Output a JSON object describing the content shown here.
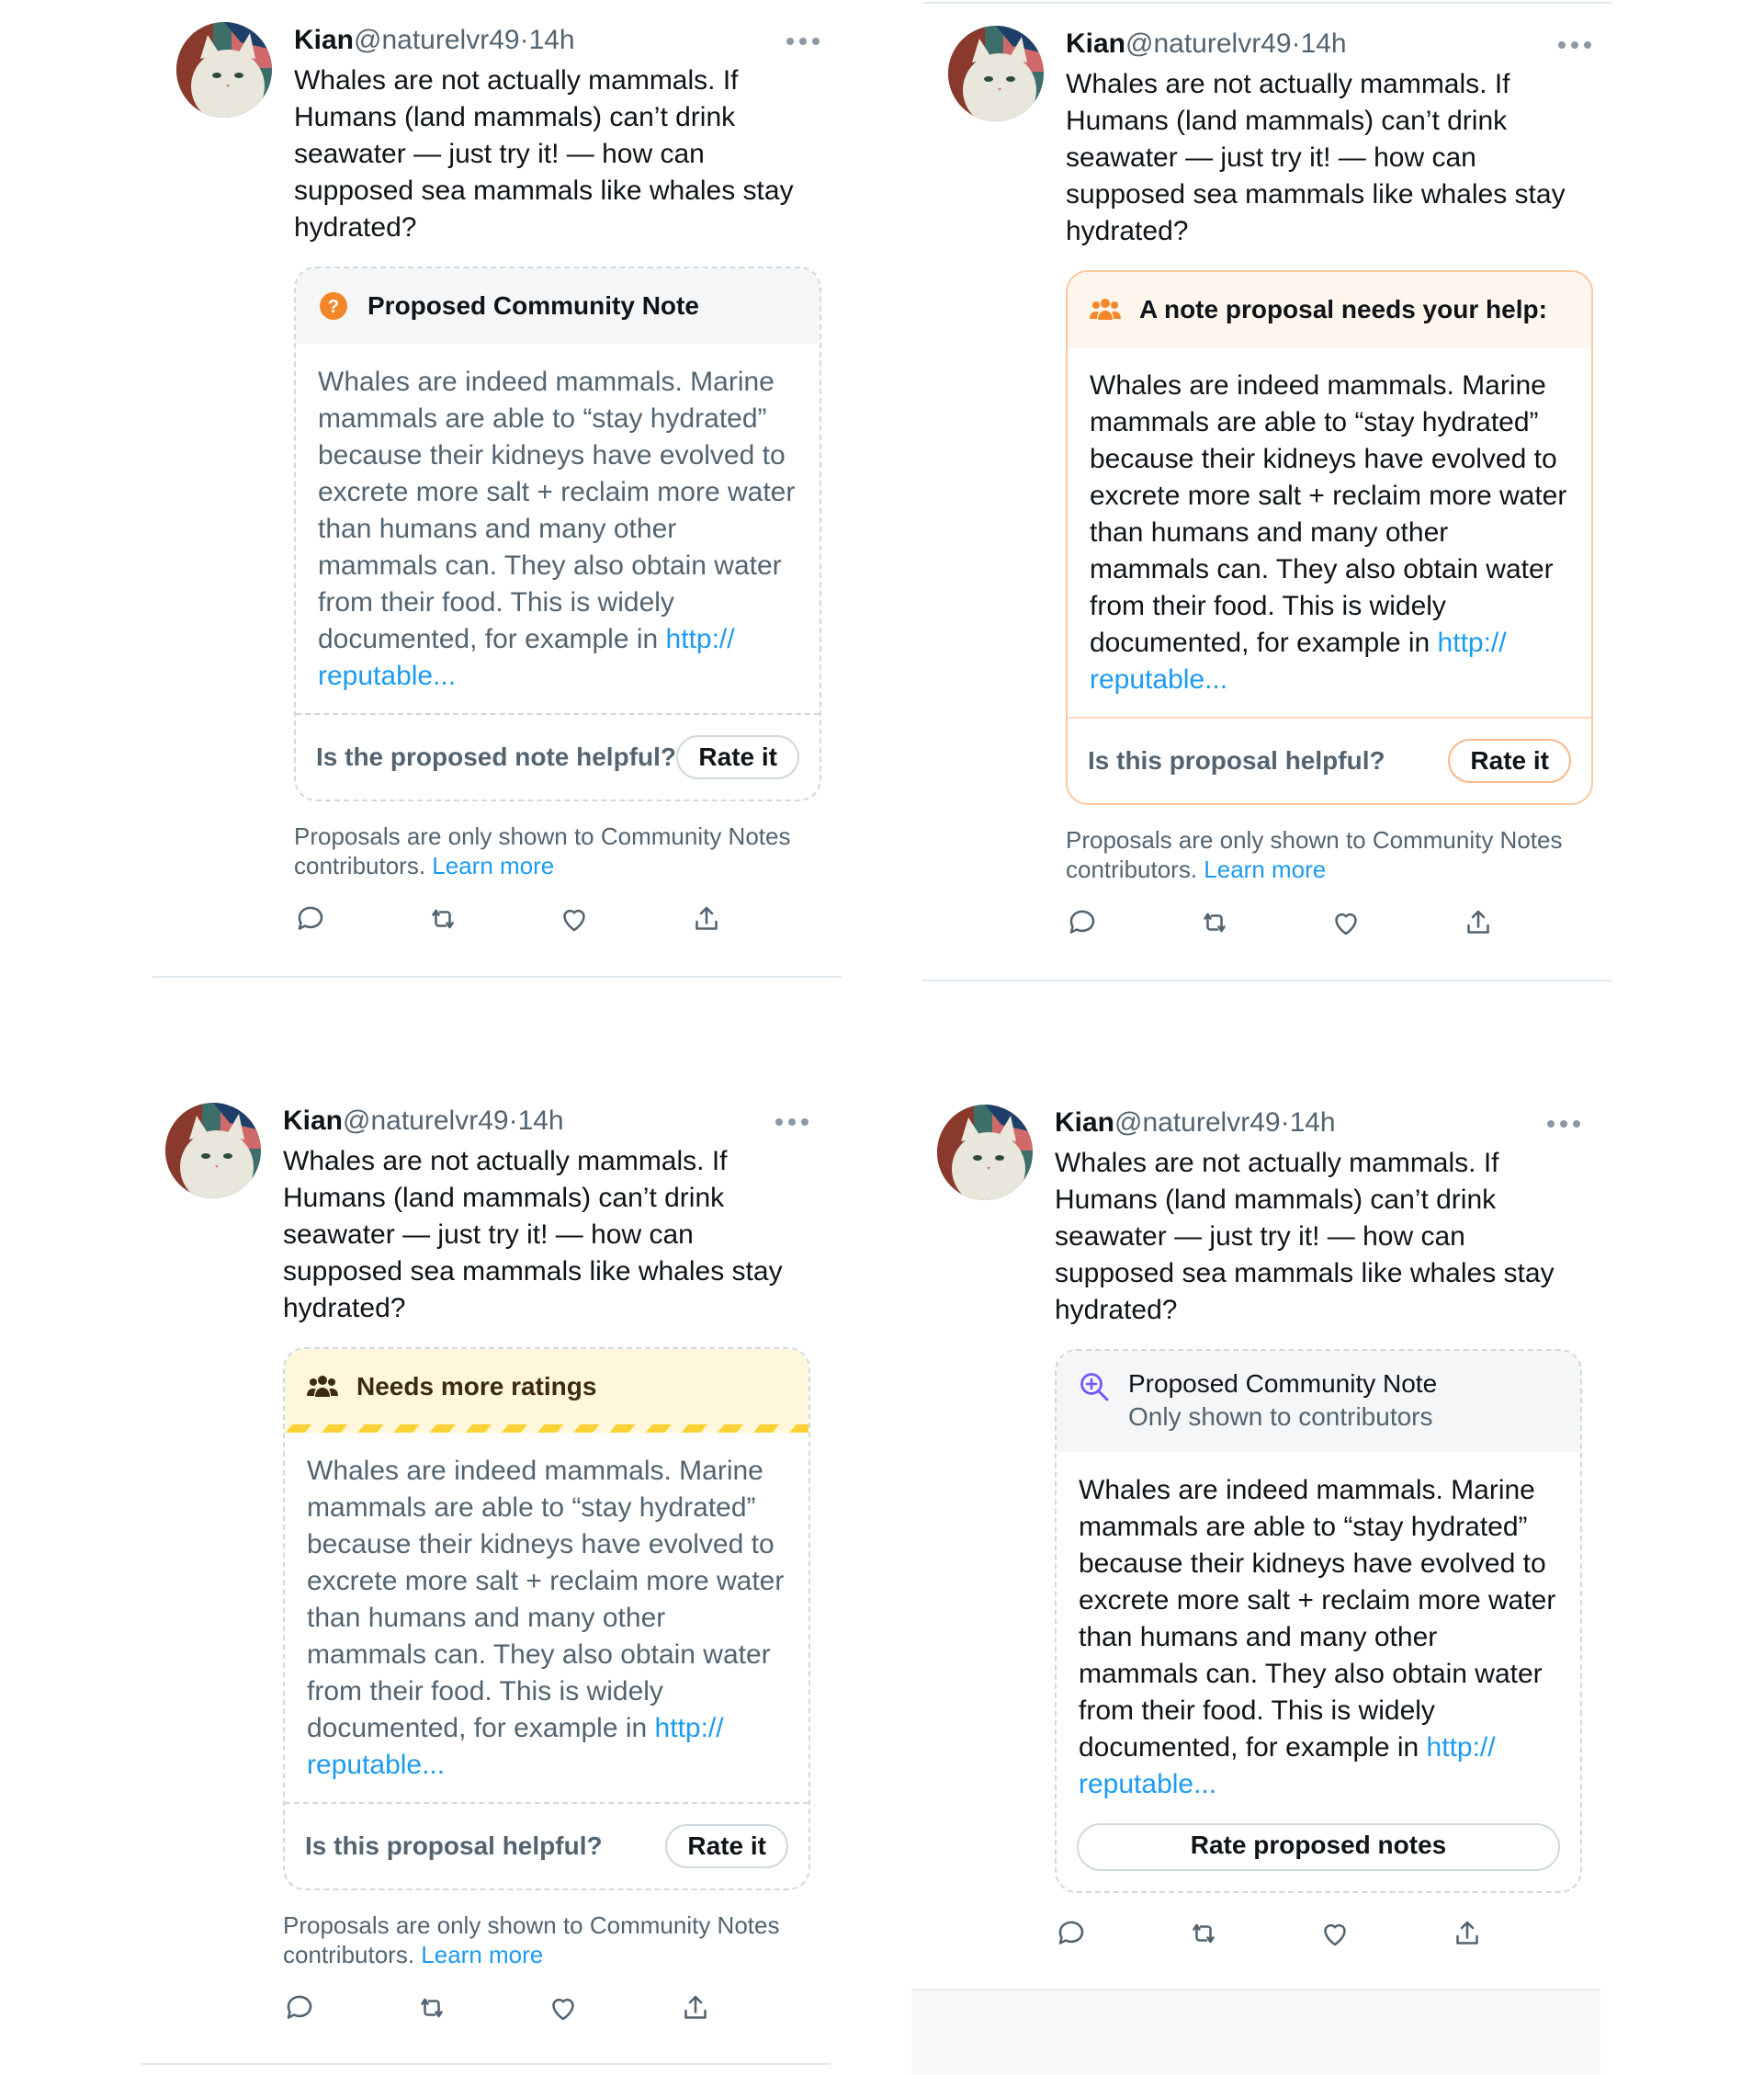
{
  "tweets": [
    {
      "author": {
        "name": "Kian",
        "handle": "@naturelvr49",
        "sep": "·",
        "time": "14h"
      },
      "text": "Whales are not actually mammals. If Humans (land mammals) can’t drink seawater — just try it! — how can supposed sea mammals like whales stay hydrated?",
      "note": {
        "header": "Proposed Community Note",
        "body": "Whales are indeed mammals. Marine mammals are able to “stay hydrated” because their kidneys have evolved to excrete more salt + reclaim more water than humans and many other mammals can. They also obtain water from their food. This is widely documented, for example in ",
        "link": "http:// reputable...",
        "question": "Is the proposed note helpful?",
        "button": "Rate it"
      },
      "disclaimer": "Proposals are only shown to Community Notes contributors. ",
      "learn_more": "Learn more"
    },
    {
      "author": {
        "name": "Kian",
        "handle": "@naturelvr49",
        "sep": "·",
        "time": "14h"
      },
      "text": "Whales are not actually mammals. If Humans (land mammals) can’t drink seawater — just try it! — how can supposed sea mammals like whales stay hydrated?",
      "note": {
        "header": "A note proposal needs your help:",
        "body": "Whales are indeed mammals. Marine mammals are able to “stay hydrated” because their kidneys have evolved to excrete more salt + reclaim more water than humans and many other mammals can. They also obtain water from their food. This is widely documented, for example in ",
        "link": "http:// reputable...",
        "question": "Is this proposal helpful?",
        "button": "Rate it"
      },
      "disclaimer": "Proposals are only shown to Community Notes contributors. ",
      "learn_more": "Learn more"
    },
    {
      "author": {
        "name": "Kian",
        "handle": "@naturelvr49",
        "sep": "·",
        "time": "14h"
      },
      "text": "Whales are not actually mammals. If Humans (land mammals) can’t drink seawater — just try it! — how can supposed sea mammals like whales stay hydrated?",
      "note": {
        "header": "Needs more ratings",
        "body": "Whales are indeed mammals. Marine mammals are able to “stay hydrated” because their kidneys have evolved to excrete more salt + reclaim more water than humans and many other mammals can. They also obtain water from their food. This is widely documented, for example in ",
        "link": "http:// reputable...",
        "question": "Is this proposal helpful?",
        "button": "Rate it"
      },
      "disclaimer": "Proposals are only shown to Community Notes contributors. ",
      "learn_more": "Learn more"
    },
    {
      "author": {
        "name": "Kian",
        "handle": "@naturelvr49",
        "sep": "·",
        "time": "14h"
      },
      "text": "Whales are not actually mammals. If Humans (land mammals) can’t drink seawater — just try it! — how can supposed sea mammals like whales stay hydrated?",
      "note": {
        "header": "Proposed Community Note",
        "subheader": "Only shown to contributors",
        "body": "Whales are indeed mammals. Marine mammals are able to “stay hydrated” because their kidneys have evolved to excrete more salt + reclaim more water than humans and many other mammals can. They also obtain water from their food. This is widely documented, for example in ",
        "link": "http:// reputable...",
        "button": "Rate proposed notes"
      }
    }
  ],
  "colors": {
    "link": "#1d9bf0",
    "orange": "#f4862a",
    "purple": "#7856ff",
    "caution_yellow": "#fbd235",
    "muted": "#536471"
  },
  "icons": [
    "more-icon",
    "question-icon",
    "people-icon",
    "magnify-plus-icon",
    "reply-icon",
    "retweet-icon",
    "like-icon",
    "share-icon"
  ]
}
